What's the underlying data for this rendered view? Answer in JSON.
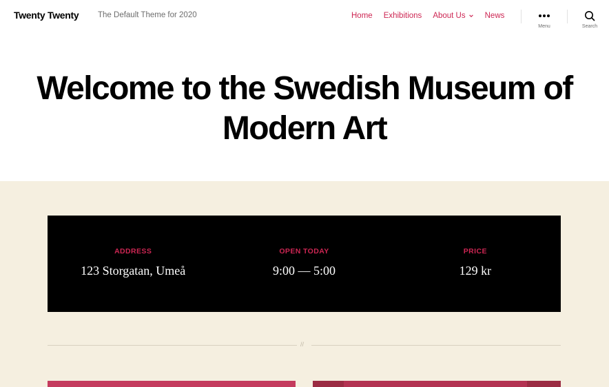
{
  "header": {
    "site_title": "Twenty Twenty",
    "site_description": "The Default Theme for 2020",
    "nav": [
      {
        "label": "Home"
      },
      {
        "label": "Exhibitions"
      },
      {
        "label": "About Us",
        "has_submenu": true
      },
      {
        "label": "News"
      }
    ],
    "menu_toggle_label": "Menu",
    "search_toggle_label": "Search",
    "menu_icon": "ellipsis-icon",
    "search_icon": "search-icon"
  },
  "hero": {
    "title": "Welcome to the Swedish Museum of Modern Art"
  },
  "info": [
    {
      "label": "ADDRESS",
      "value": "123 Storgatan, Umeå"
    },
    {
      "label": "OPEN TODAY",
      "value": "9:00 — 5:00"
    },
    {
      "label": "PRICE",
      "value": "129 kr"
    }
  ],
  "separator_mark": "//",
  "colors": {
    "accent": "#cd2653",
    "beige_background": "#f5efe0",
    "info_background": "#000000",
    "secondary_text": "#6d6d6d"
  }
}
